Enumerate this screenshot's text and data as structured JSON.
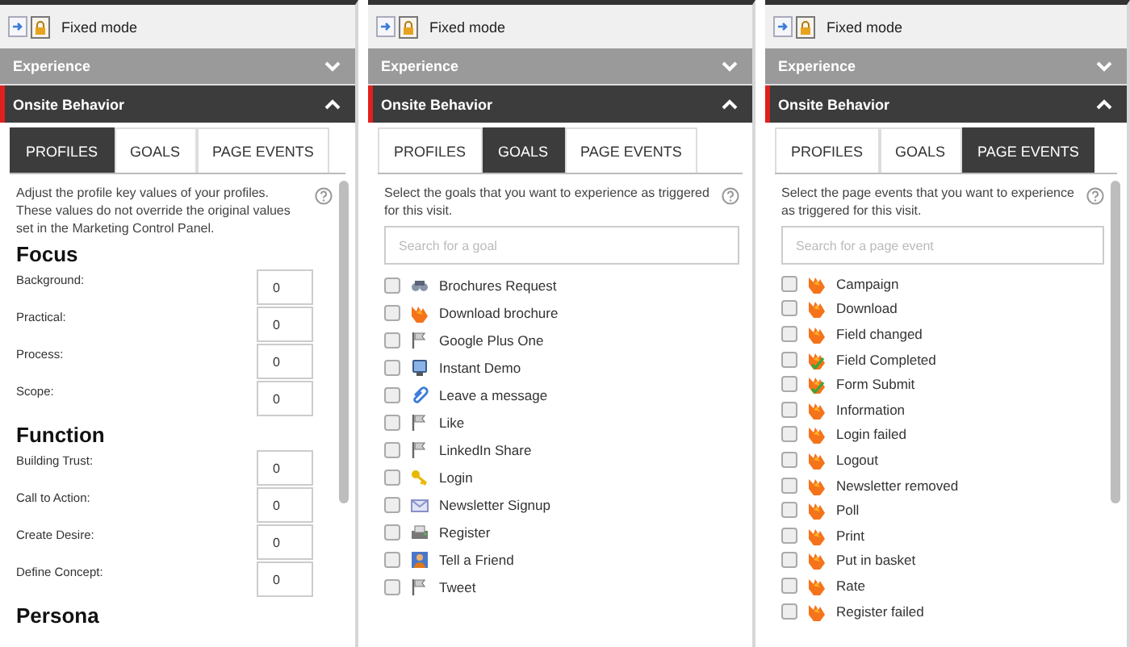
{
  "panels": [
    {
      "header": {
        "title": "Fixed mode"
      },
      "sections": [
        {
          "title": "Experience",
          "expanded": false
        },
        {
          "title": "Onsite Behavior",
          "expanded": true
        }
      ],
      "tabs": [
        {
          "label": "PROFILES",
          "selected": true
        },
        {
          "label": "GOALS",
          "selected": false
        },
        {
          "label": "PAGE EVENTS",
          "selected": false
        }
      ],
      "content": {
        "kind": "profiles",
        "description": "Adjust the profile key values of your profiles. These values do not override the original values set in the Marketing Control Panel.",
        "groups": [
          {
            "title": "Focus",
            "fields": [
              {
                "label": "Background:",
                "value": "0"
              },
              {
                "label": "Practical:",
                "value": "0"
              },
              {
                "label": "Process:",
                "value": "0"
              },
              {
                "label": "Scope:",
                "value": "0"
              }
            ]
          },
          {
            "title": "Function",
            "fields": [
              {
                "label": "Building Trust:",
                "value": "0"
              },
              {
                "label": "Call to Action:",
                "value": "0"
              },
              {
                "label": "Create Desire:",
                "value": "0"
              },
              {
                "label": "Define Concept:",
                "value": "0"
              }
            ]
          },
          {
            "title": "Persona"
          }
        ]
      }
    },
    {
      "header": {
        "title": "Fixed mode"
      },
      "sections": [
        {
          "title": "Experience",
          "expanded": false
        },
        {
          "title": "Onsite Behavior",
          "expanded": true
        }
      ],
      "tabs": [
        {
          "label": "PROFILES",
          "selected": false
        },
        {
          "label": "GOALS",
          "selected": true
        },
        {
          "label": "PAGE EVENTS",
          "selected": false
        }
      ],
      "content": {
        "kind": "list",
        "description": "Select the goals that you want to experience as triggered for this visit.",
        "search": {
          "placeholder": "Search for a goal"
        },
        "items": [
          {
            "label": "Brochures Request",
            "kind": "binoculars",
            "checked": false
          },
          {
            "label": "Download brochure",
            "kind": "flame",
            "checked": false
          },
          {
            "label": "Google Plus One",
            "kind": "flag",
            "checked": false
          },
          {
            "label": "Instant Demo",
            "kind": "monitor",
            "checked": false
          },
          {
            "label": "Leave a message",
            "kind": "paperclip",
            "checked": false
          },
          {
            "label": "Like",
            "kind": "flag",
            "checked": false
          },
          {
            "label": "LinkedIn Share",
            "kind": "flag",
            "checked": false
          },
          {
            "label": "Login",
            "kind": "key",
            "checked": false
          },
          {
            "label": "Newsletter Signup",
            "kind": "envelope",
            "checked": false
          },
          {
            "label": "Register",
            "kind": "register",
            "checked": false
          },
          {
            "label": "Tell a Friend",
            "kind": "person",
            "checked": false
          },
          {
            "label": "Tweet",
            "kind": "flag",
            "checked": false
          }
        ]
      }
    },
    {
      "header": {
        "title": "Fixed mode"
      },
      "sections": [
        {
          "title": "Experience",
          "expanded": false
        },
        {
          "title": "Onsite Behavior",
          "expanded": true
        }
      ],
      "tabs": [
        {
          "label": "PROFILES",
          "selected": false
        },
        {
          "label": "GOALS",
          "selected": false
        },
        {
          "label": "PAGE EVENTS",
          "selected": true
        }
      ],
      "content": {
        "kind": "list",
        "description": "Select the page events that you want to experience as triggered for this visit.",
        "search": {
          "placeholder": "Search for a page event"
        },
        "items": [
          {
            "label": "Campaign",
            "kind": "flame",
            "checked": false
          },
          {
            "label": "Download",
            "kind": "flame",
            "checked": false
          },
          {
            "label": "Field changed",
            "kind": "flame",
            "checked": false
          },
          {
            "label": "Field Completed",
            "kind": "flame-check",
            "checked": false
          },
          {
            "label": "Form Submit",
            "kind": "flame-check",
            "checked": false
          },
          {
            "label": "Information",
            "kind": "flame",
            "checked": false
          },
          {
            "label": "Login failed",
            "kind": "flame",
            "checked": false
          },
          {
            "label": "Logout",
            "kind": "flame",
            "checked": false
          },
          {
            "label": "Newsletter removed",
            "kind": "flame",
            "checked": false
          },
          {
            "label": "Poll",
            "kind": "flame",
            "checked": false
          },
          {
            "label": "Print",
            "kind": "flame",
            "checked": false
          },
          {
            "label": "Put in basket",
            "kind": "flame",
            "checked": false
          },
          {
            "label": "Rate",
            "kind": "flame",
            "checked": false
          },
          {
            "label": "Register failed",
            "kind": "flame",
            "checked": false
          }
        ]
      }
    }
  ]
}
